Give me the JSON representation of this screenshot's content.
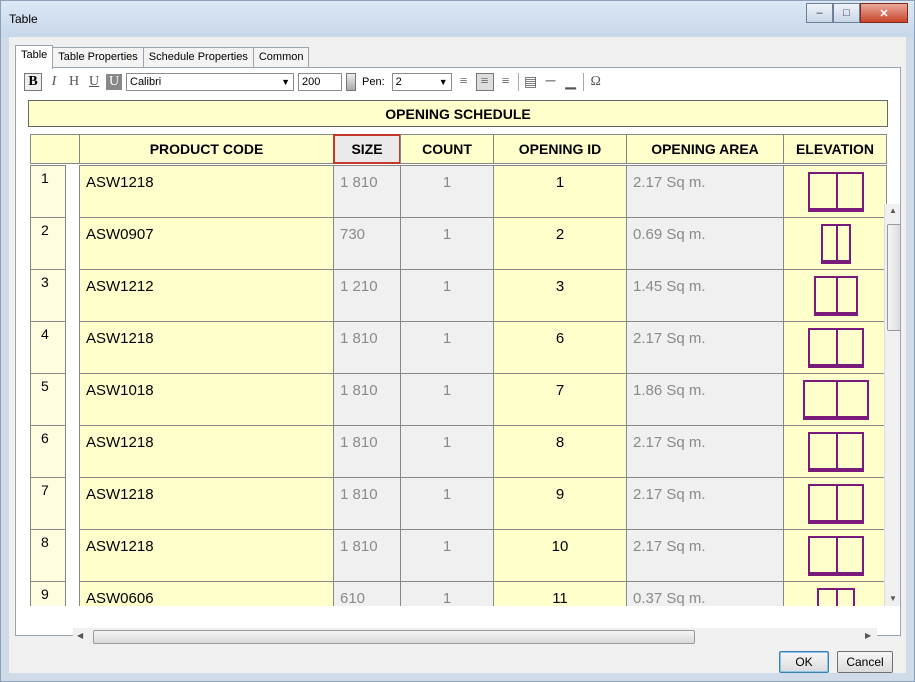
{
  "window": {
    "title": "Table"
  },
  "tabs": [
    "Table",
    "Table Properties",
    "Schedule Properties",
    "Common"
  ],
  "toolbar": {
    "bold": "B",
    "italic": "I",
    "outline": "H",
    "underline": "U",
    "shade": "U",
    "font": "Calibri",
    "size": "200",
    "pen_label": "Pen:",
    "pen_value": "2"
  },
  "schedule": {
    "title": "OPENING SCHEDULE",
    "headers": [
      "PRODUCT CODE",
      "SIZE",
      "COUNT",
      "OPENING ID",
      "OPENING AREA",
      "ELEVATION"
    ],
    "rows": [
      {
        "num": "1",
        "code": "ASW1218",
        "size": "1 810",
        "count": "1",
        "id": "1",
        "area": "2.17 Sq m."
      },
      {
        "num": "2",
        "code": "ASW0907",
        "size": "730",
        "count": "1",
        "id": "2",
        "area": "0.69 Sq m."
      },
      {
        "num": "3",
        "code": "ASW1212",
        "size": "1 210",
        "count": "1",
        "id": "3",
        "area": "1.45 Sq m."
      },
      {
        "num": "4",
        "code": "ASW1218",
        "size": "1 810",
        "count": "1",
        "id": "6",
        "area": "2.17 Sq m."
      },
      {
        "num": "5",
        "code": "ASW1018",
        "size": "1 810",
        "count": "1",
        "id": "7",
        "area": "1.86 Sq m."
      },
      {
        "num": "6",
        "code": "ASW1218",
        "size": "1 810",
        "count": "1",
        "id": "8",
        "area": "2.17 Sq m."
      },
      {
        "num": "7",
        "code": "ASW1218",
        "size": "1 810",
        "count": "1",
        "id": "9",
        "area": "2.17 Sq m."
      },
      {
        "num": "8",
        "code": "ASW1218",
        "size": "1 810",
        "count": "1",
        "id": "10",
        "area": "2.17 Sq m."
      },
      {
        "num": "9",
        "code": "ASW0606",
        "size": "610",
        "count": "1",
        "id": "11",
        "area": "0.37 Sq m."
      }
    ]
  },
  "buttons": {
    "ok": "OK",
    "cancel": "Cancel"
  },
  "colors": {
    "cell_bg": "#ffffcc",
    "window_elevation": "#7a1a7a",
    "selected_header_border": "#c0392b"
  }
}
